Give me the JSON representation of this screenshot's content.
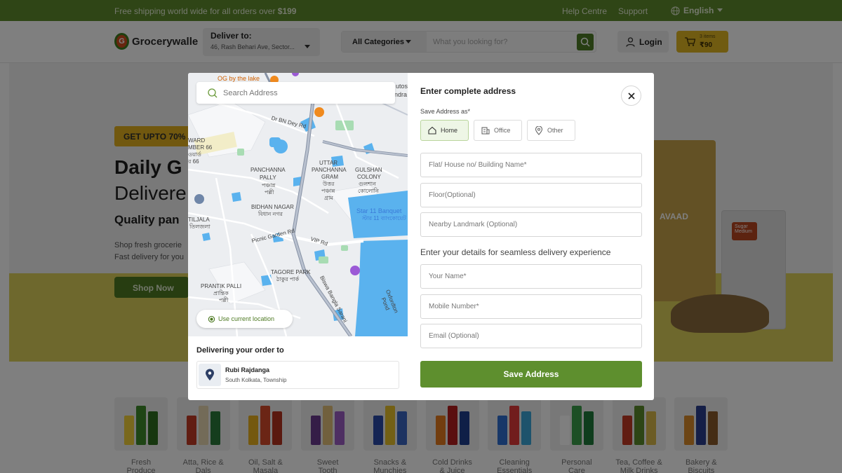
{
  "topbar": {
    "promo_prefix": "Free shipping world wide for all orders over ",
    "promo_amount": "$199",
    "help": "Help Centre",
    "support": "Support",
    "language": "English"
  },
  "header": {
    "brand": "Grocerywalle",
    "logo_letter": "G",
    "deliver_label": "Deliver to:",
    "deliver_address": "46, Rash Behari Ave, Sector...",
    "category": "All Categories",
    "search_placeholder": "What you looking for?",
    "login": "Login",
    "cart_count": "3 items",
    "cart_total": "₹90"
  },
  "hero": {
    "badge": "GET UPTO 70% O",
    "heading_1": "Daily G",
    "heading_2": "Delivere",
    "heading_3": "Quality pan",
    "text_1": "Shop fresh grocerie",
    "text_2": "Fast delivery for you",
    "cta": "Shop Now",
    "product_label": "AVAAD",
    "product_tag": "Sugar Medium"
  },
  "categories": [
    {
      "line1": "Fresh",
      "line2": "Produce",
      "colors": [
        "#f2d13a",
        "#3e8b2a",
        "#2f6e1f"
      ]
    },
    {
      "line1": "Atta, Rice &",
      "line2": "Dals",
      "colors": [
        "#c23a24",
        "#e7d7b0",
        "#2b7a3a"
      ]
    },
    {
      "line1": "Oil, Salt &",
      "line2": "Masala",
      "colors": [
        "#e8b01e",
        "#d64a2a",
        "#b5321e"
      ]
    },
    {
      "line1": "Sweet",
      "line2": "Tooth",
      "colors": [
        "#6a3b8e",
        "#e3c07a",
        "#9c5fc4"
      ]
    },
    {
      "line1": "Snacks &",
      "line2": "Munchies",
      "colors": [
        "#2b4ba8",
        "#e7c12a",
        "#3a66c2"
      ]
    },
    {
      "line1": "Cold Drinks",
      "line2": "& Juice",
      "colors": [
        "#e57b1e",
        "#b51f1f",
        "#1f3e8e"
      ]
    },
    {
      "line1": "Cleaning",
      "line2": "Essentials",
      "colors": [
        "#2f6ed0",
        "#e23a3a",
        "#3aa6d8"
      ]
    },
    {
      "line1": "Personal",
      "line2": "Care",
      "colors": [
        "#ffffff",
        "#3b9e4a",
        "#1f7a3a"
      ]
    },
    {
      "line1": "Tea, Coffee &",
      "line2": "Milk Drinks",
      "colors": [
        "#c23a24",
        "#5a8a2a",
        "#d8b84a"
      ]
    },
    {
      "line1": "Bakery &",
      "line2": "Biscuits",
      "colors": [
        "#d88a2a",
        "#2b3f8e",
        "#8a5a2a"
      ]
    }
  ],
  "modal": {
    "map_search_placeholder": "Search Address",
    "use_location": "Use current location",
    "delivering_label": "Delivering your order to",
    "location_name": "Rubi Rajdanga",
    "location_area": "South Kolkata, Township",
    "title": "Enter complete address",
    "save_as_label": "Save Address as*",
    "types": [
      "Home",
      "Office",
      "Other"
    ],
    "fields": {
      "flat": "Flat/ House no/ Building Name*",
      "floor": "Floor(Optional)",
      "landmark": "Nearby Landmark (Optional)",
      "name": "Your Name*",
      "mobile": "Mobile Number*",
      "email": "Email (Optional)"
    },
    "details_note": "Enter your details for seamless delivery experience",
    "save_button": "Save Address"
  },
  "map_labels": {
    "og": "OG by the lake",
    "autos": "utos",
    "andra": "ndra",
    "bn_dey": "Dr BN Dey Rd",
    "ward_1": "WARD",
    "ward_2": "MBER 66",
    "ward_3": "ওয়ার্ড",
    "ward_4": "র 66",
    "panchanna_1": "PANCHANNA",
    "panchanna_2": "PALLY",
    "panchanna_3": "পঞ্চান্ন",
    "panchanna_4": "পল্লী",
    "uttar_1": "UTTAR",
    "uttar_2": "PANCHANNA",
    "uttar_3": "GRAM",
    "uttar_4": "উত্তর",
    "uttar_5": "পঞ্চান্ন",
    "uttar_6": "গ্রাম",
    "gulshan_1": "GULSHAN",
    "gulshan_2": "COLONY",
    "gulshan_3": "গুলশান",
    "gulshan_4": "কোলোনি",
    "bidhan_1": "BIDHAN NAGAR",
    "bidhan_2": "বিধান নগর",
    "star_1": "Star 11 Banquet",
    "star_2": "স্টার 11 ব্যাংকোয়েট",
    "tiljala_1": "TILJALA",
    "tiljala_2": "তিলজলা",
    "picnic": "Picnic Garden Rd",
    "vip": "VIP Rd",
    "tagore_1": "TAGORE PARK",
    "tagore_2": "ঠাকুর পার্ক",
    "prantik_1": "PRANTIK PALLI",
    "prantik_2": "প্রান্তিক",
    "prantik_3": "পল্লী",
    "biswa": "Biswa Bangla Sarani",
    "oxford": "Oxfordton Pond"
  },
  "icons": {
    "search": "magnifier-icon",
    "globe": "globe-icon",
    "user": "user-icon",
    "cart": "cart-icon",
    "close": "close-icon",
    "home": "home-icon",
    "office": "building-icon",
    "other": "pin-icon",
    "location": "target-icon"
  },
  "colors": {
    "brand_green": "#5e8f2e",
    "accent_yellow": "#e0b623"
  }
}
